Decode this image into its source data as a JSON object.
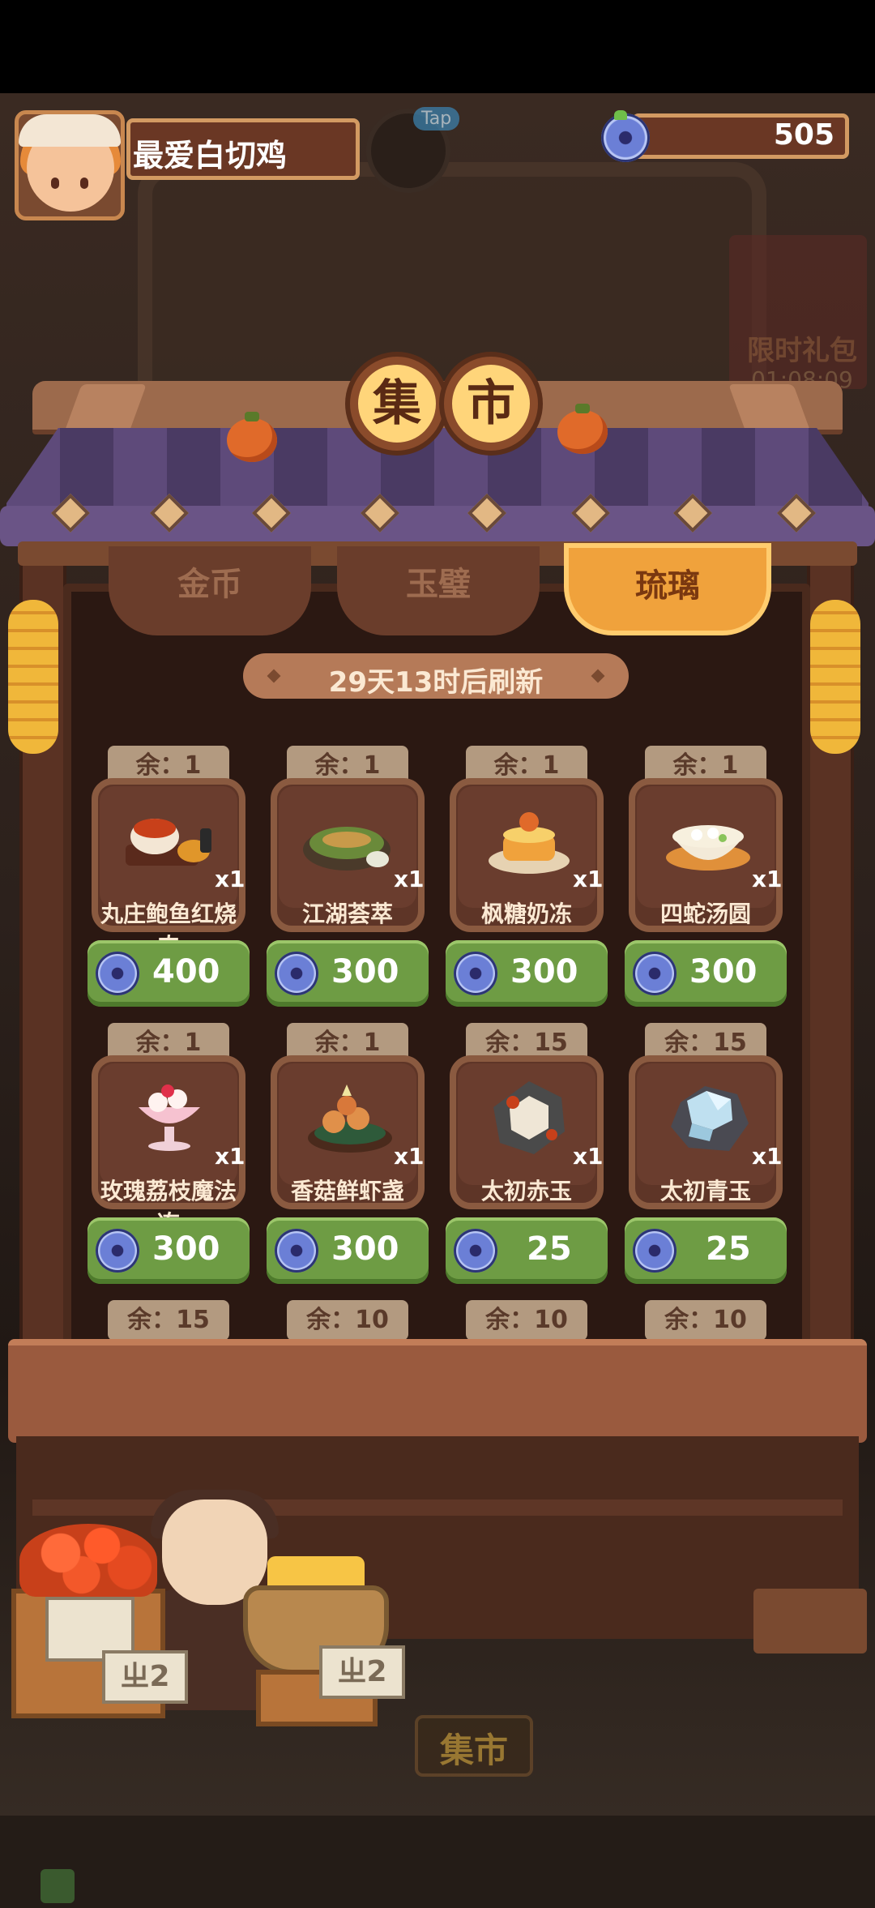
{
  "header": {
    "player_name": "最爱白切鸡",
    "tap_label": "Tap",
    "currency_value": "505"
  },
  "promo": {
    "label": "限时礼包",
    "timer": "01:08:09"
  },
  "market": {
    "title_char_1": "集",
    "title_char_2": "市",
    "tabs": [
      {
        "label": "金币",
        "active": false
      },
      {
        "label": "玉璧",
        "active": false
      },
      {
        "label": "琉璃",
        "active": true
      }
    ],
    "refresh_text": "29天13时后刷新",
    "items": [
      {
        "remain": "余：1",
        "name": "丸庄鲍鱼红烧肉",
        "qty": "x1",
        "price": "400",
        "icon": "braised-pork-icon"
      },
      {
        "remain": "余：1",
        "name": "江湖荟萃",
        "qty": "x1",
        "price": "300",
        "icon": "jianghu-platter-icon"
      },
      {
        "remain": "余：1",
        "name": "枫糖奶冻",
        "qty": "x1",
        "price": "300",
        "icon": "maple-pudding-icon"
      },
      {
        "remain": "余：1",
        "name": "四蛇汤圆",
        "qty": "x1",
        "price": "300",
        "icon": "rice-ball-soup-icon"
      },
      {
        "remain": "余：1",
        "name": "玫瑰荔枝魔法冻",
        "qty": "x1",
        "price": "300",
        "icon": "rose-lychee-jelly-icon"
      },
      {
        "remain": "余：1",
        "name": "香菇鲜虾盏",
        "qty": "x1",
        "price": "300",
        "icon": "mushroom-shrimp-cup-icon"
      },
      {
        "remain": "余：15",
        "name": "太初赤玉",
        "qty": "x1",
        "price": "25",
        "icon": "red-jade-icon"
      },
      {
        "remain": "余：15",
        "name": "太初青玉",
        "qty": "x1",
        "price": "25",
        "icon": "green-jade-icon"
      }
    ],
    "next_row_remain": [
      "余：15",
      "余：10",
      "余：10",
      "余：10"
    ]
  },
  "stall": {
    "sign_left": "ㄓ2",
    "sign_right": "ㄓ2",
    "bottom_button": "集市"
  },
  "colors": {
    "price_button": "#6e9c44",
    "active_tab": "#f0a23c",
    "gem": "#6b7fd6"
  }
}
